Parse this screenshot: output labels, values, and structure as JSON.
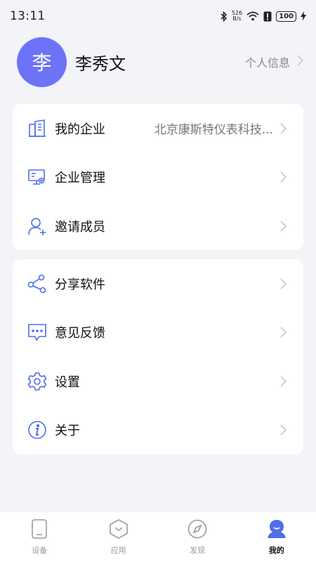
{
  "status": {
    "time": "13:11",
    "net_speed_top": "526",
    "net_speed_bottom": "B/s",
    "battery": "100"
  },
  "profile": {
    "avatar_text": "李",
    "name": "李秀文",
    "info_link": "个人信息"
  },
  "menu_group_1": [
    {
      "label": "我的企业",
      "value": "北京康斯特仪表科技...",
      "icon": "building-icon"
    },
    {
      "label": "企业管理",
      "icon": "monitor-settings-icon"
    },
    {
      "label": "邀请成员",
      "icon": "user-add-icon"
    }
  ],
  "menu_group_2": [
    {
      "label": "分享软件",
      "icon": "share-icon"
    },
    {
      "label": "意见反馈",
      "icon": "feedback-icon"
    },
    {
      "label": "设置",
      "icon": "gear-icon"
    },
    {
      "label": "关于",
      "icon": "info-icon"
    }
  ],
  "bottom_nav": [
    {
      "label": "设备",
      "icon": "device-icon",
      "active": false
    },
    {
      "label": "应用",
      "icon": "app-icon",
      "active": false
    },
    {
      "label": "发现",
      "icon": "compass-icon",
      "active": false
    },
    {
      "label": "我的",
      "icon": "profile-icon",
      "active": true
    }
  ],
  "colors": {
    "accent": "#6d73f7",
    "icon_blue": "#4f6ee8",
    "background": "#f3f4f8"
  }
}
